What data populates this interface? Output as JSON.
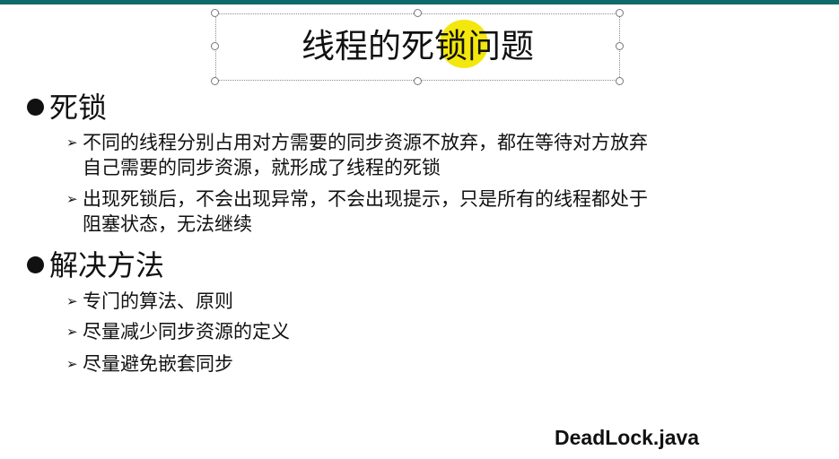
{
  "slide": {
    "title": "线程的死锁问题",
    "sections": [
      {
        "heading": "死锁",
        "items": [
          {
            "line1": "不同的线程分别占用对方需要的同步资源不放弃，都在等待对方放弃",
            "line2": "自己需要的同步资源，就形成了线程的死锁"
          },
          {
            "line1": "出现死锁后，不会出现异常，不会出现提示，只是所有的线程都处于",
            "line2": "阻塞状态，无法继续"
          }
        ]
      },
      {
        "heading": "解决方法",
        "items": [
          {
            "line1": "专门的算法、原则"
          },
          {
            "line1": "尽量减少同步资源的定义"
          },
          {
            "line1": "尽量避免嵌套同步"
          }
        ]
      }
    ],
    "filename": "DeadLock.java"
  },
  "icons": {
    "bullet": "filled-circle-bullet",
    "sub_bullet": "arrowhead-bullet"
  },
  "colors": {
    "top_bar": "#0f6b6b",
    "highlight": "#f2e600"
  }
}
